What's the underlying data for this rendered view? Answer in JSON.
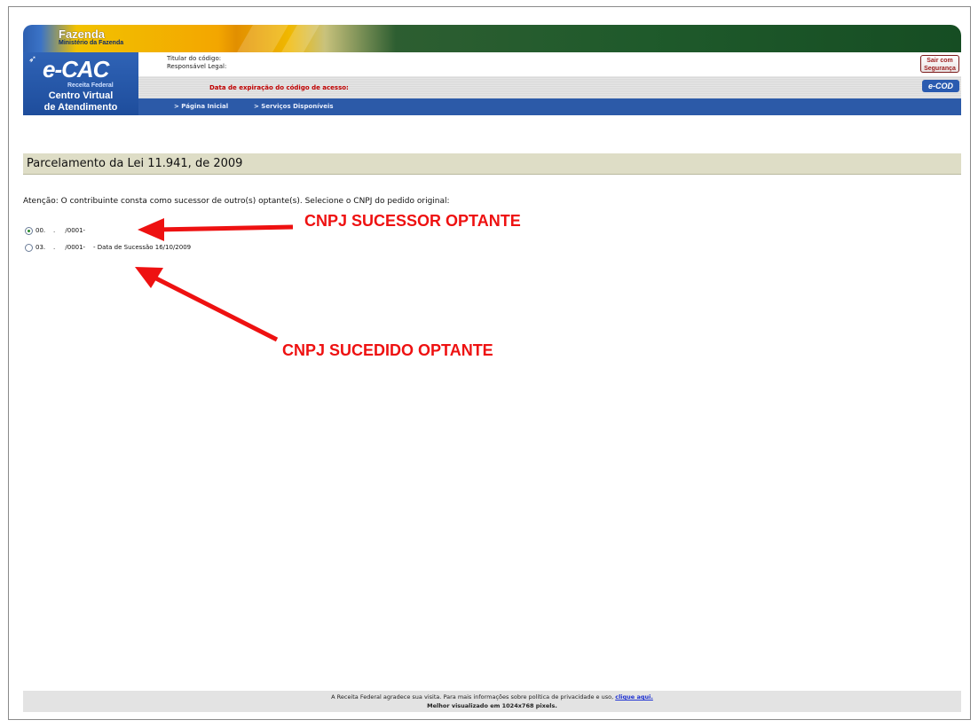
{
  "header": {
    "brand": "Fazenda",
    "ministry": "Ministério da Fazenda",
    "logo": "e-CAC",
    "receita": "Receita Federal",
    "centro_line1": "Centro Virtual",
    "centro_line2": "de Atendimento",
    "titular_label": "Titular do código:",
    "responsavel_label": "Responsável Legal:",
    "expiracao_label": "Data de expiração do código de acesso:",
    "nav": [
      "> Página Inicial",
      "> Serviços Disponíveis"
    ],
    "sair_button": "Sair com\nSegurança",
    "ecod_button": "e-COD",
    "bird_icon": "receita-bird-icon"
  },
  "page": {
    "title": "Parcelamento da Lei 11.941, de 2009",
    "attention": "Atenção: O contribuinte consta como sucessor de outro(s) optante(s). Selecione o CNPJ do pedido original:"
  },
  "options": [
    {
      "label": "00.    .     /0001-",
      "selected": true
    },
    {
      "label": "03.    .     /0001-    - Data de Sucessão 16/10/2009",
      "selected": false
    }
  ],
  "annotations": {
    "sucessor": "CNPJ SUCESSOR OPTANTE",
    "sucedido": "CNPJ SUCEDIDO OPTANTE",
    "color": "#ee1111"
  },
  "footer": {
    "text_before_link": "A Receita Federal agradece sua visita. Para mais informações sobre política de privacidade e uso, ",
    "link": "clique aqui.",
    "line2": "Melhor visualizado em 1024x768 pixels."
  }
}
